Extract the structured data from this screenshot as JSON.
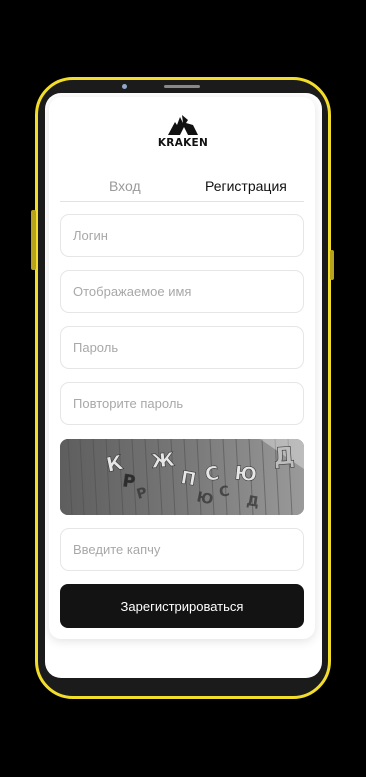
{
  "brand": {
    "name": "KRAKEN",
    "accent_color": "#f3dd2b"
  },
  "tabs": {
    "login": "Вход",
    "register": "Регистрация",
    "active": "register"
  },
  "form": {
    "login_placeholder": "Логин",
    "display_name_placeholder": "Отображаемое имя",
    "password_placeholder": "Пароль",
    "repeat_password_placeholder": "Повторите пароль",
    "captcha_placeholder": "Введите капчу",
    "submit_label": "Зарегистрироваться"
  },
  "captcha": {
    "characters": [
      "К",
      "Р",
      "Ж",
      "П",
      "С",
      "Ю",
      "Д"
    ]
  }
}
